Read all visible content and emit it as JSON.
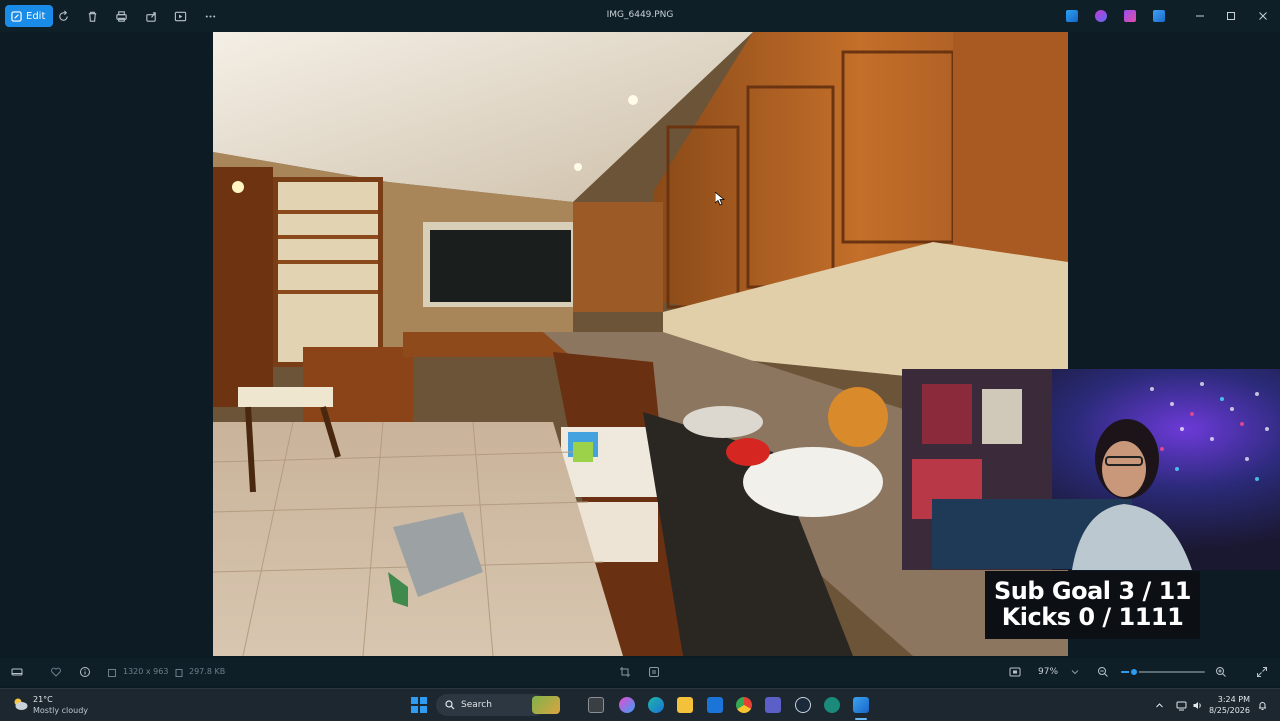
{
  "toolbar": {
    "edit_label": "Edit",
    "file_name": "IMG_6449.PNG",
    "icons": [
      "edit-icon",
      "rotate-icon",
      "delete-icon",
      "print-icon",
      "share-icon",
      "slideshow-icon",
      "more-icon"
    ],
    "window_controls": [
      "minimize-icon",
      "restore-icon",
      "close-icon"
    ]
  },
  "overlay": {
    "line1": "Sub Goal 3 / 11",
    "line2": "Kicks 0 / 1111"
  },
  "bottombar": {
    "dimensions": "1320 x 963",
    "file_size": "297.8 KB",
    "zoom": "97%",
    "zoom_fraction": 0.15
  },
  "taskbar": {
    "weather_temp": "21°C",
    "weather_desc": "Mostly cloudy",
    "search_placeholder": "Search",
    "time": "3:24 PM",
    "date": "8/25/2026"
  },
  "colors": {
    "accent": "#1a8ce8",
    "toolbar_bg": "#0f1f28",
    "taskbar_bg": "#1c2730"
  }
}
